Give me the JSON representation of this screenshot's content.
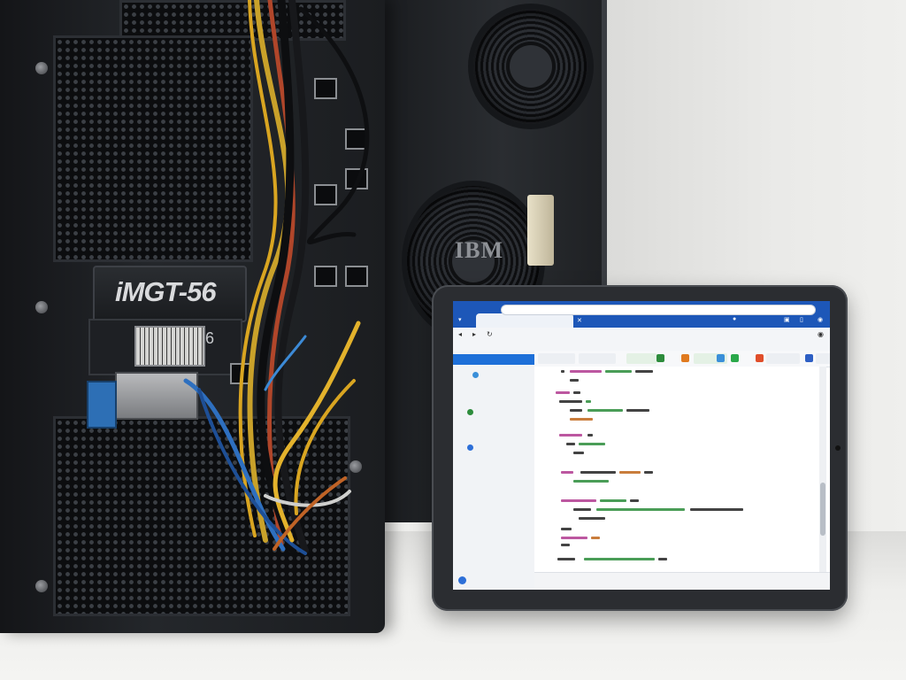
{
  "scene": {
    "rear_tower_brand": "IBM",
    "front_tower_nameplate": "iMGT-56",
    "front_tower_bay_number": "6"
  },
  "tablet": {
    "browser": {
      "active_tab_label": "",
      "toolbar_icons": [
        "back-icon",
        "reload-icon",
        "profile-icon",
        "menu-icon"
      ]
    },
    "sidebar": {
      "items": [
        {
          "label": "",
          "active": true
        },
        {
          "label": ""
        },
        {
          "label": ""
        },
        {
          "label": ""
        },
        {
          "label": ""
        },
        {
          "label": ""
        },
        {
          "label": ""
        }
      ],
      "footer_label": ""
    },
    "editor_tab_colors": [
      "#2d8c3c",
      "#e07a1f",
      "#3a8fd9",
      "#2aa84a",
      "#e04e2a",
      "#2d5fc4",
      "#3ba55c"
    ],
    "code_colors": {
      "keyword": "#b03a8f",
      "string": "#2a8c3a",
      "number": "#c0661a",
      "text": "#222222"
    }
  },
  "colors": {
    "browser_accent": "#1d57b8",
    "sidebar_active": "#1d6fd8",
    "tower_dark": "#1a1c1f"
  }
}
